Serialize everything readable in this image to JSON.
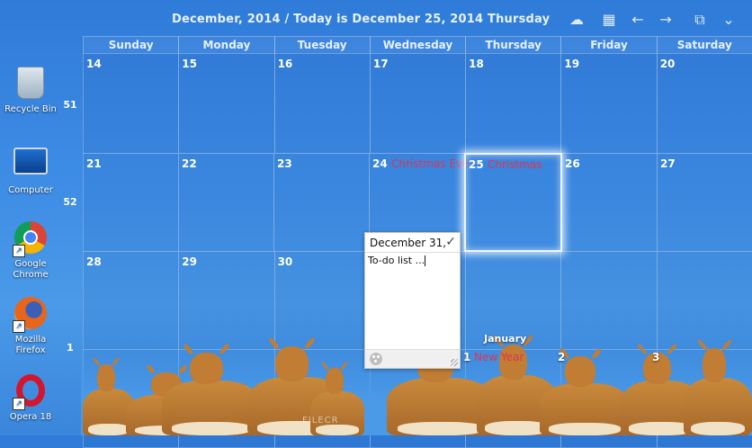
{
  "desktop": {
    "icons": [
      {
        "label": "Recycle Bin",
        "icon": "recycle-bin-icon"
      },
      {
        "label": "Computer",
        "icon": "computer-icon"
      },
      {
        "label": "Google Chrome",
        "icon": "chrome-icon"
      },
      {
        "label": "Mozilla Firefox",
        "icon": "firefox-icon"
      },
      {
        "label": "Opera 18",
        "icon": "opera-icon"
      }
    ]
  },
  "calendar": {
    "title": "December, 2014 / Today is December 25, 2014 Thursday",
    "toolbar_icons": [
      "cloud-icon",
      "calendar-icon",
      "arrow-left-icon",
      "arrow-right-icon",
      "window-icon",
      "chevron-down-icon"
    ],
    "day_names": [
      "Sunday",
      "Monday",
      "Tuesday",
      "Wednesday",
      "Thursday",
      "Friday",
      "Saturday"
    ],
    "weeks": [
      {
        "week": "51",
        "days": [
          "14",
          "15",
          "16",
          "17",
          "18",
          "19",
          "20"
        ],
        "events": {}
      },
      {
        "week": "52",
        "days": [
          "21",
          "22",
          "23",
          "24",
          "25",
          "26",
          "27"
        ],
        "events": {
          "3": "Christmas Eve",
          "4": "Christmas"
        }
      },
      {
        "week": "",
        "days": [
          "28",
          "29",
          "30",
          "",
          "",
          "",
          ""
        ],
        "events": {}
      },
      {
        "week": "1",
        "days": [
          "",
          "",
          "",
          "",
          "1",
          "2",
          "3"
        ],
        "events": {
          "4": "New Year"
        }
      }
    ],
    "next_month_label": "January",
    "today_index": {
      "week": 1,
      "day": 4
    },
    "colors": {
      "event": "#e03450",
      "header_text": "#e8f2ff"
    }
  },
  "sticky_note": {
    "title": "December 31,",
    "body": "To-do list ..."
  },
  "watermark": "FILECR"
}
